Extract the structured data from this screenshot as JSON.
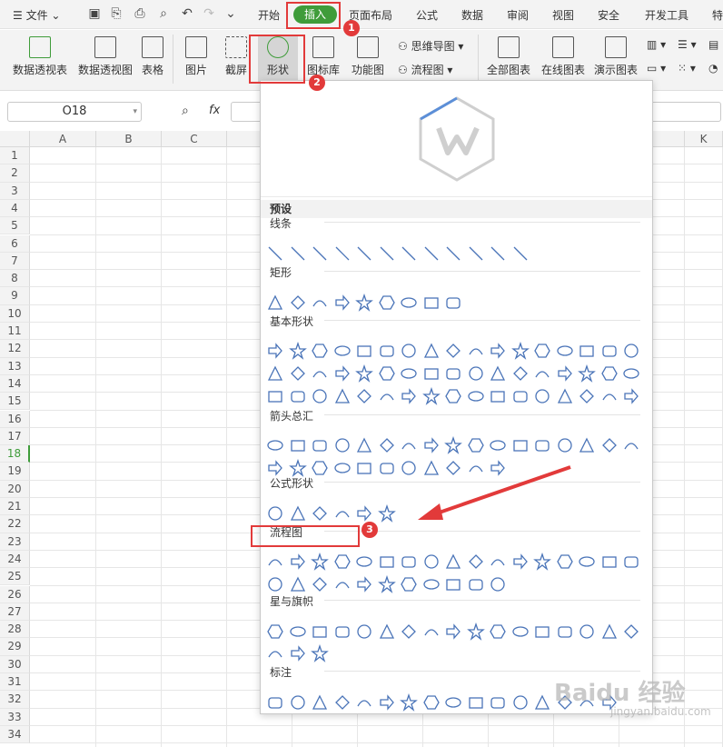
{
  "menubar": {
    "file_label": "文件",
    "tabs": [
      "开始",
      "插入",
      "页面布局",
      "公式",
      "数据",
      "审阅",
      "视图",
      "安全",
      "开发工具",
      "特"
    ],
    "active_tab": "插入"
  },
  "ribbon": {
    "big_buttons": [
      "数据透视表",
      "数据透视图",
      "表格",
      "图片",
      "截屏",
      "形状",
      "图标库",
      "功能图",
      "全部图表",
      "在线图表",
      "演示图表"
    ],
    "small_buttons": [
      "思维导图",
      "流程图"
    ]
  },
  "formula_bar": {
    "cell_ref": "O18",
    "fx": "fx"
  },
  "grid": {
    "columns": [
      "A",
      "B",
      "C",
      "",
      "",
      "",
      "",
      "",
      "",
      "",
      "K"
    ],
    "rows": [
      "1",
      "2",
      "3",
      "4",
      "5",
      "6",
      "7",
      "8",
      "9",
      "10",
      "11",
      "12",
      "13",
      "14",
      "15",
      "16",
      "17",
      "18",
      "19",
      "20",
      "21",
      "22",
      "23",
      "24",
      "25",
      "26",
      "27",
      "28",
      "29",
      "30",
      "31",
      "32",
      "33",
      "34"
    ],
    "selected_row": "18"
  },
  "shapes_panel": {
    "preset_label": "预设",
    "sections": [
      {
        "title": "线条",
        "count": 12
      },
      {
        "title": "矩形",
        "count": 9
      },
      {
        "title": "基本形状",
        "count": 51
      },
      {
        "title": "箭头总汇",
        "count": 28
      },
      {
        "title": "公式形状",
        "count": 6
      },
      {
        "title": "流程图",
        "count": 28
      },
      {
        "title": "星与旗帜",
        "count": 20
      },
      {
        "title": "标注",
        "count": 16
      }
    ]
  },
  "annotations": {
    "steps": [
      "1",
      "2",
      "3"
    ]
  },
  "watermark": {
    "text": "Baidu 经验",
    "url": "jingyan.baidu.com"
  },
  "colors": {
    "accent_green": "#3f9c3a",
    "annotation_red": "#e23a3a",
    "shape_blue": "#4a74b8"
  }
}
